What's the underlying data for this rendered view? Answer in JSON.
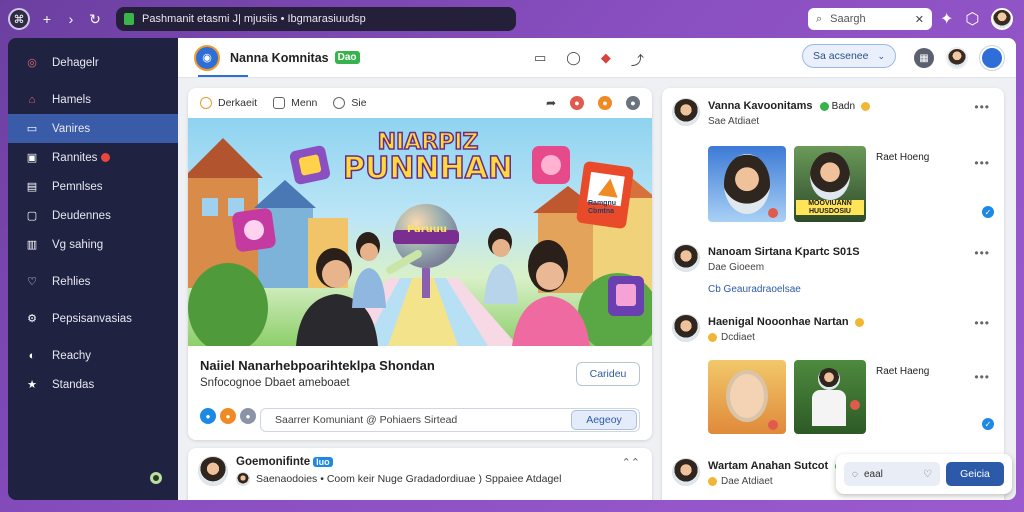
{
  "browser": {
    "url": "Pashmanit etasmi J| mjusiis • Ibgmarasiuudsp",
    "search_label": "Saargh",
    "search_close": "✕"
  },
  "sidebar": {
    "items": [
      {
        "label": "Dehagelr",
        "icon": "target-icon"
      },
      {
        "label": "Hamels",
        "icon": "home-icon"
      },
      {
        "label": "Vanires",
        "icon": "video-icon",
        "active": true
      },
      {
        "label": "Rannites",
        "icon": "group-icon",
        "notification": true
      },
      {
        "label": "Pemnlses",
        "icon": "calendar-icon"
      },
      {
        "label": "Deudennes",
        "icon": "page-icon"
      },
      {
        "label": "Vg sahing",
        "icon": "shop-icon"
      },
      {
        "label": "Rehlies",
        "icon": "heart-icon"
      },
      {
        "label": "Pepsisanvasias",
        "icon": "settings-icon"
      },
      {
        "label": "Reachy",
        "icon": "compass-icon"
      },
      {
        "label": "Standas",
        "icon": "star-icon"
      }
    ]
  },
  "topbar": {
    "title": "Nanna Komnitas",
    "badge": "Dao",
    "sort_label": "Sa acsenee",
    "sort_chevron": "⌄"
  },
  "post": {
    "tabs": [
      "Derkaeit",
      "Menn",
      "Sie"
    ],
    "hero_title_line1": "NIARPIZ",
    "hero_title_line2": "PUNNHAN",
    "hero_sign": "Paruuu",
    "hero_card": "Ramgnu Cbmtna",
    "headline": "Naiiel Nanarhebpoarihteklpa Shondan",
    "subheadline": "Snfocognoe Dbaet ameboaet",
    "cta_label": "Carideu",
    "comment_placeholder": "Saarrer Komuniant @ Pohiaers Sirtead",
    "comment_send": "Aegeoy"
  },
  "next_post": {
    "name": "Goemonifinte",
    "badge": "luo",
    "subtitle": "Saenaodoies • Coom keir Nuge Gradadordiuae ) Sppaiee Atdagel"
  },
  "right_panel": {
    "entries": [
      {
        "name": "Vanna Kavoonitams",
        "badge": "Badn",
        "subtitle": "Sae Atdiaet",
        "thumb_label": "Raet Hoeng",
        "thumb_caption": "MOOVIUANN HUUSDOSIU"
      },
      {
        "name": "Nanoam Sirtana Kpartc S01S",
        "subtitle": "Dae Gioeem",
        "link": "Cb Geauradraoelsae"
      },
      {
        "name": "Haenigal Nooonhae Nartan",
        "subtitle": "Dcdiaet",
        "thumb_label": "Raet Haeng"
      },
      {
        "name": "Wartam Anahan Sutcot",
        "subtitle": "Dae Atdiaet"
      }
    ]
  },
  "float_bar": {
    "input_label": "eaal",
    "button_label": "Geicia"
  },
  "colors": {
    "accent": "#2d6fd6",
    "sidebar_bg": "#1f2240",
    "sidebar_active": "#3a5ba8",
    "page_bg": "#8a4fc1"
  }
}
